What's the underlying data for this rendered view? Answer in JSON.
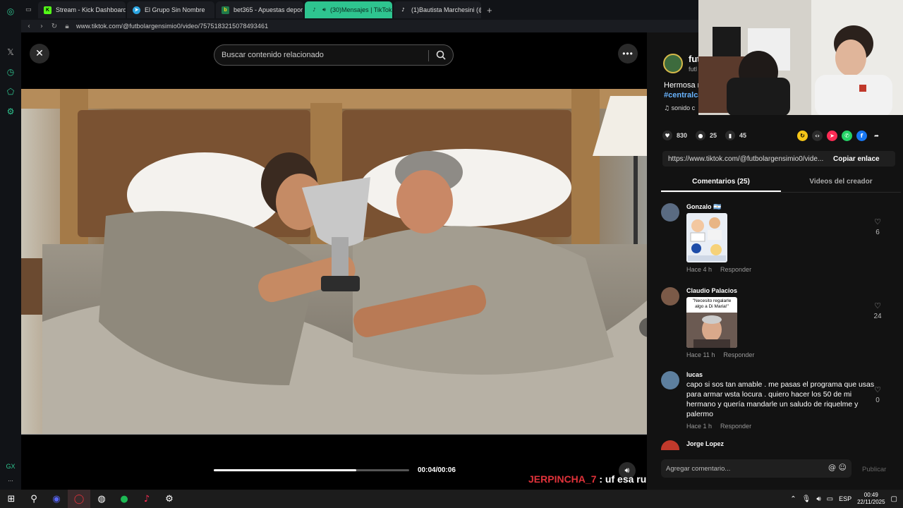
{
  "browser": {
    "tabs": [
      {
        "label": "Stream - Kick Dashboard",
        "icon": "kick-icon",
        "active": false
      },
      {
        "label": "El Grupo Sin Nombre",
        "icon": "telegram-icon",
        "active": false
      },
      {
        "label": "bet365 - Apuestas depor",
        "icon": "bet365-icon",
        "active": false
      },
      {
        "label": "(30)Mensajes | TikTok",
        "icon": "tiktok-icon",
        "active": true
      },
      {
        "label": "(1)Bautista Marchesini (@",
        "icon": "tiktok-icon",
        "active": false
      }
    ],
    "new_tab": "+",
    "url": "www.tiktok.com/@futbolargensimio0/video/7575183215078493461"
  },
  "viewer": {
    "search_placeholder": "Buscar contenido relacionado",
    "more": "•••",
    "time": "00:04/00:06",
    "progress_fraction": 0.73
  },
  "chat_overlay": {
    "user": "JERPINCHA_7",
    "message": " : uf esa rubia"
  },
  "panel": {
    "creator_name": "fut",
    "creator_handle": "futl",
    "description_line1": "Hermosa r",
    "hashtag": "#centralca",
    "sound": "sonido c",
    "likes": "830",
    "comments_count": "25",
    "saves": "45",
    "link": "https://www.tiktok.com/@futbolargensimio0/vide...",
    "copy_label": "Copiar enlace",
    "tab_comments": "Comentarios (25)",
    "tab_videos": "Videos del creador",
    "comment_placeholder": "Agregar comentario...",
    "input_icons": "@ ☺",
    "publish_label": "Publicar"
  },
  "comments": [
    {
      "name": "Gonzalo 🇦🇷",
      "text": "",
      "time": "Hace 4 h",
      "reply": "Responder",
      "likes": "6"
    },
    {
      "name": "Claudio Palacios",
      "text": "",
      "sticker_text": "\"Necesito regalarle algo a Di Maria!\"",
      "time": "Hace 11 h",
      "reply": "Responder",
      "likes": "24"
    },
    {
      "name": "lucas",
      "text": "capo si sos tan amable . me pasas el programa que usas para armar wsta locura . quiero hacer los 50 de mi hermano y quería mandarle un saludo de riquelme y palermo",
      "time": "Hace 1 h",
      "reply": "Responder",
      "likes": "0"
    },
    {
      "name": "Jorge Lopez",
      "text": "",
      "time": "",
      "reply": "",
      "likes": ""
    }
  ],
  "taskbar": {
    "lang": "ESP",
    "time": "00:49",
    "date": "22/11/2025"
  },
  "sidebar": {
    "gx_label": "GX",
    "more": "..."
  },
  "colors": {
    "opera_accent": "#2ec48f",
    "chat_user": "#e0323a",
    "hashtag": "#69b4ff"
  }
}
